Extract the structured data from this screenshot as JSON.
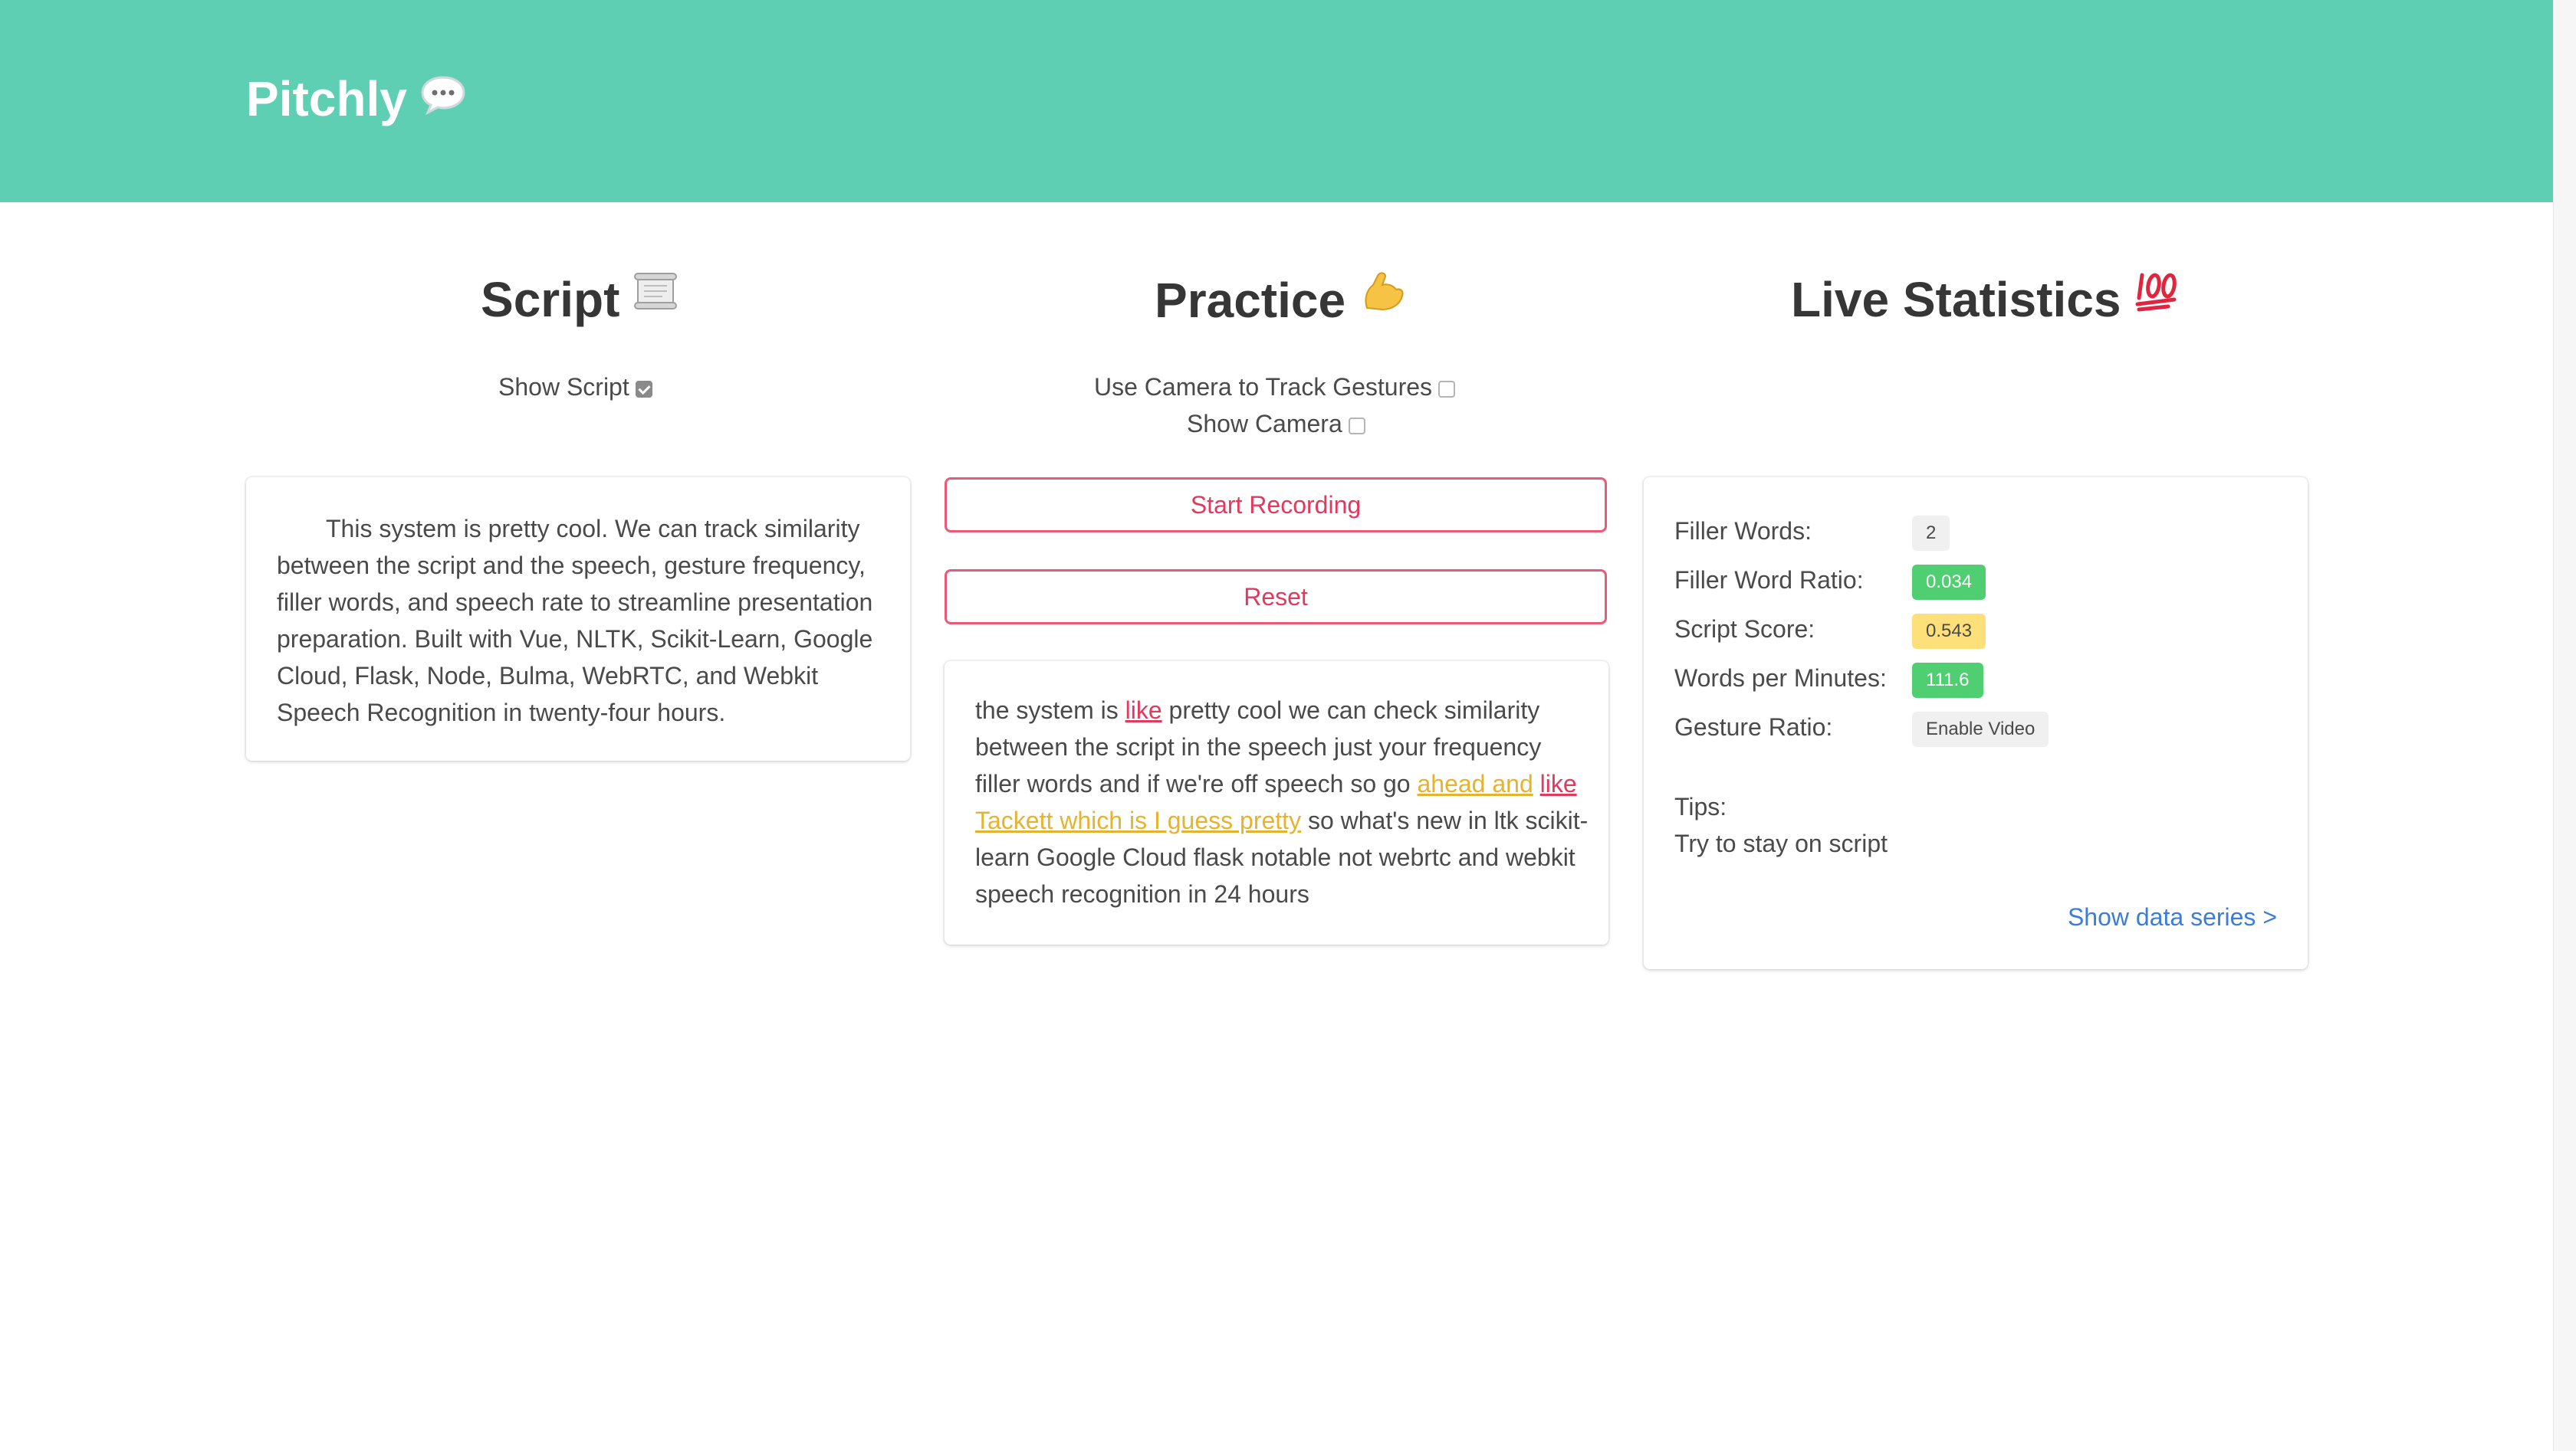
{
  "app": {
    "title": "Pitchly",
    "icon": "speech-bubble-icon",
    "header_color": "#5fcfb4"
  },
  "script": {
    "title": "Script",
    "emoji": "📜",
    "show_script_label": "Show Script",
    "show_script_checked": true,
    "text": "This system is pretty cool. We can track similarity between the script and the speech, gesture frequency, filler words, and speech rate to streamline presentation preparation. Built with Vue, NLTK, Scikit-Learn, Google Cloud, Flask, Node, Bulma, WebRTC, and Webkit Speech Recognition in twenty-four hours."
  },
  "practice": {
    "title": "Practice",
    "emoji": "💪",
    "camera_gestures_label": "Use Camera to Track Gestures",
    "camera_gestures_checked": false,
    "show_camera_label": "Show Camera",
    "show_camera_checked": false,
    "start_button": "Start Recording",
    "reset_button": "Reset",
    "transcript": [
      {
        "text": "the system is ",
        "type": "normal"
      },
      {
        "text": "like",
        "type": "filler"
      },
      {
        "text": " pretty cool we can check similarity between the script in the speech just your frequency filler words and if we're off speech so go ",
        "type": "normal"
      },
      {
        "text": "ahead and",
        "type": "offscript"
      },
      {
        "text": " ",
        "type": "normal"
      },
      {
        "text": "like",
        "type": "filler"
      },
      {
        "text": " ",
        "type": "normal"
      },
      {
        "text": "Tackett which is I guess pretty",
        "type": "offscript"
      },
      {
        "text": " so what's new in ltk scikit-learn Google Cloud flask notable not webrtc and webkit speech recognition in 24 hours",
        "type": "normal"
      }
    ],
    "colors": {
      "filler": "#e23a5e",
      "offscript": "#e6b32e",
      "button": "#e23a5e"
    }
  },
  "stats": {
    "title": "Live Statistics",
    "emoji": "💯",
    "rows": [
      {
        "label": "Filler Words:",
        "value": "2",
        "color": "grey"
      },
      {
        "label": "Filler Word Ratio:",
        "value": "0.034",
        "color": "green"
      },
      {
        "label": "Script Score:",
        "value": "0.543",
        "color": "yellow"
      },
      {
        "label": "Words per Minutes:",
        "value": "111.6",
        "color": "green"
      },
      {
        "label": "Gesture Ratio:",
        "value": "Enable Video",
        "color": "grey"
      }
    ],
    "tips_label": "Tips:",
    "tips_text": "Try to stay on script",
    "show_data_link": "Show data series >"
  }
}
